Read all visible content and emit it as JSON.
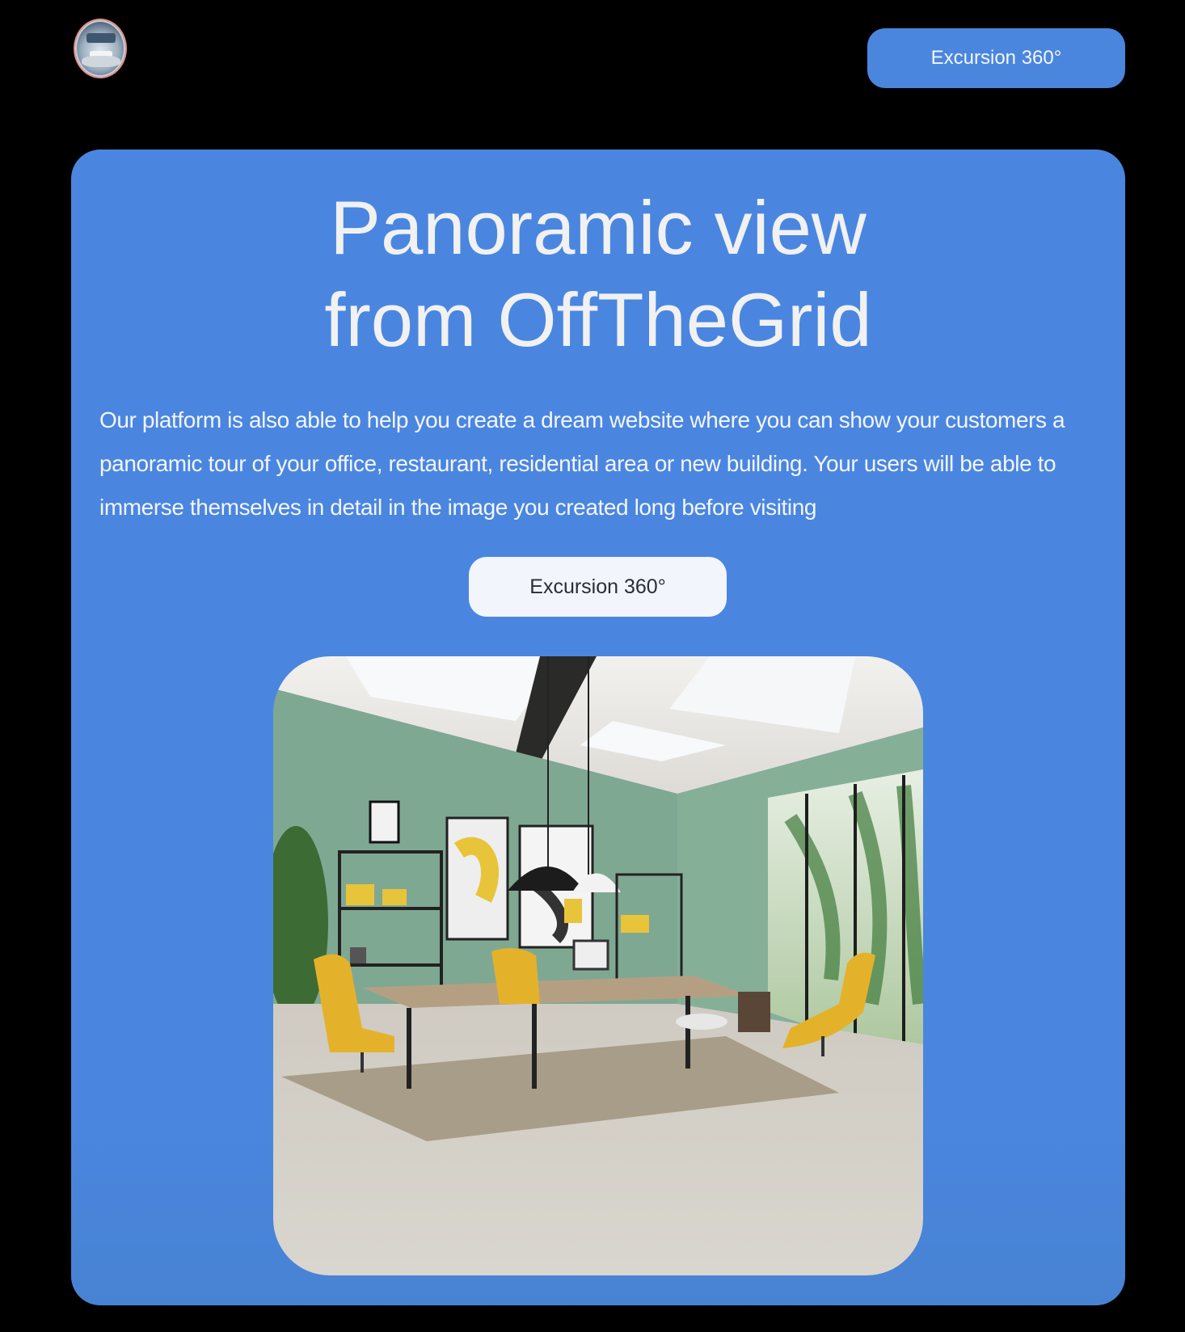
{
  "header": {
    "logo_icon": "panorama-room-logo-icon",
    "cta_label": "Excursion 360°"
  },
  "hero": {
    "title_line1": "Panoramic view",
    "title_line2": "from OffTheGrid",
    "description": "Our platform is also able to help you create a dream website where you can show your customers a panoramic tour of your office, restaurant, residential area or new building. Your users will be able to immerse themselves in detail in the image you created long before visiting",
    "cta_label": "Excursion 360°",
    "image_icon": "office-interior-image"
  },
  "colors": {
    "background": "#000000",
    "accent": "#4a86e0",
    "button_light": "#f3f5fc",
    "text_light": "#f1f1f1"
  }
}
